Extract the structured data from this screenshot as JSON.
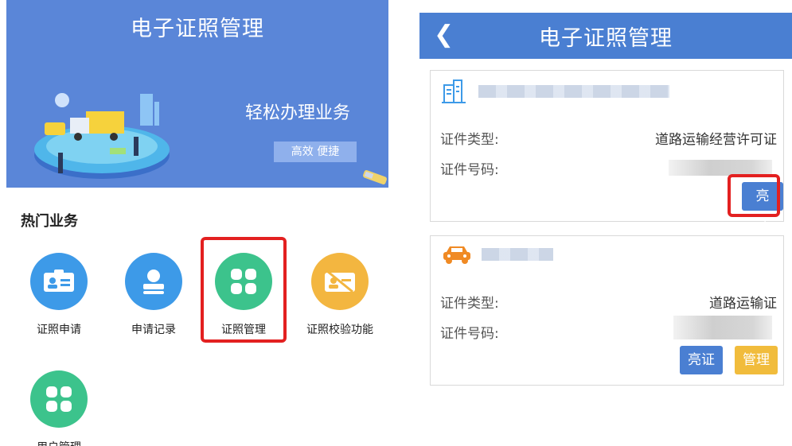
{
  "left_screen": {
    "title": "电子证照管理",
    "banner": {
      "slogan": "轻松办理业务",
      "tag": "高效 便捷"
    },
    "section_title": "热门业务",
    "tiles": [
      {
        "label": "证照申请",
        "icon": "id-card-icon",
        "color": "#3d9ae8"
      },
      {
        "label": "申请记录",
        "icon": "user-record-icon",
        "color": "#3d9ae8"
      },
      {
        "label": "证照管理",
        "icon": "grid-icon",
        "color": "#3cc38c"
      },
      {
        "label": "证照校验功能",
        "icon": "verify-card-icon",
        "color": "#f3b640"
      },
      {
        "label": "用户管理",
        "icon": "grid-icon",
        "color": "#3cc38c"
      }
    ],
    "highlighted_tile": "证照管理"
  },
  "right_screen": {
    "title": "电子证照管理",
    "back_icon": "chevron-left-icon",
    "cards": [
      {
        "icon": "building-icon",
        "type_label": "证件类型:",
        "type_value": "道路运输经营许可证",
        "number_label": "证件号码:",
        "buttons": [
          "亮证"
        ]
      },
      {
        "icon": "car-icon",
        "type_label": "证件类型:",
        "type_value": "道路运输证",
        "number_label": "证件号码:",
        "buttons": [
          "亮证",
          "管理"
        ]
      }
    ]
  },
  "colors": {
    "banner": "#5a86d8",
    "nav": "#4a7fd2",
    "highlight": "#e32020",
    "button_blue": "#4a7fd2",
    "button_yellow": "#f1bc3c"
  }
}
